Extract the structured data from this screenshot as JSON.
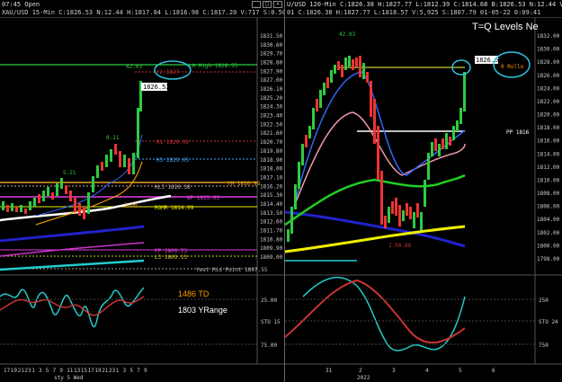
{
  "left": {
    "title_row1": "07:45 Open",
    "title_row2": "XAU/USD 15-Min  C:1826.53  N:12.44  H:1817.84  L:1816.98  C:1817.20  V:717  S:0.50  01-05-22  9:41",
    "y_ticks": [
      "1831.50",
      "1830.60",
      "1829.70",
      "1828.80",
      "1827.90",
      "1827.00",
      "1826.10",
      "1825.20",
      "1824.30",
      "1823.40",
      "1822.50",
      "1821.60",
      "1820.70",
      "1819.80",
      "1818.90",
      "1818.00",
      "1817.10",
      "1816.20",
      "1815.30",
      "1814.40",
      "1813.50",
      "1812.60",
      "1811.70",
      "1810.80",
      "1809.90",
      "1809.00"
    ],
    "price_box": "1826.53",
    "labels": {
      "lh_high": "LH High 1828.55",
      "r2": "r2 1827",
      "r1": "R1 1820.92",
      "h3": "H3 1819.05",
      "yh": "YH 1816.98",
      "hl3": "HL3 1816.38",
      "wp": "WP 1815.03",
      "roomr": "ROMR 1814.09",
      "pp": "PP 1809.73",
      "l3": "L3 1809.13",
      "yest_mid": "Yest Mid Point 1807.55",
      "v1": "42.03",
      "v2": "8.21",
      "v3": "5.21",
      "v4": "3.66"
    },
    "osc_labels": {
      "td": "1486 TD",
      "yrange": "1803 YRange",
      "o25": "25.00",
      "sto": "STO 15",
      "o75": "75.00"
    },
    "x_ticks": [
      "17",
      "19",
      "21",
      "23",
      "1",
      "3",
      "5",
      "7",
      "9",
      "11",
      "13",
      "15",
      "17",
      "19",
      "21",
      "23",
      "1",
      "3",
      "5",
      "7",
      "9"
    ],
    "x_sub": "sty 5 Wed"
  },
  "right": {
    "title_row1": "U/USD 120-Min  C:1826.38  H:1827.77  L:1812.39  C:1814.68  B:1826.53  N:12.44  V:31.8K",
    "title_row2": "01  C:1826.38  H:1827.77  L:1818.57  V:5,925  S:1807.79  01-05-22  0:09:41",
    "heading": "T=Q Levels Ne",
    "y_ticks": [
      "1832.00",
      "1830.00",
      "1828.00",
      "1826.00",
      "1824.00",
      "1822.00",
      "1820.00",
      "1818.00",
      "1816.00",
      "1814.00",
      "1812.00",
      "1810.00",
      "1808.00",
      "1806.00",
      "1804.00",
      "1802.00",
      "1800.00",
      "1798.00"
    ],
    "price_box": "1826.53",
    "circled": "0 Rollo",
    "labels": {
      "v42": "42.03",
      "pp": "PP 1816",
      "low": "1.50.88"
    },
    "osc_labels": {
      "o250": "250",
      "sto": "STO 24",
      "o750": "750"
    },
    "x_ticks": [
      "31",
      "2",
      "3",
      "4",
      "5",
      "6"
    ],
    "x_sub": "2022"
  }
}
